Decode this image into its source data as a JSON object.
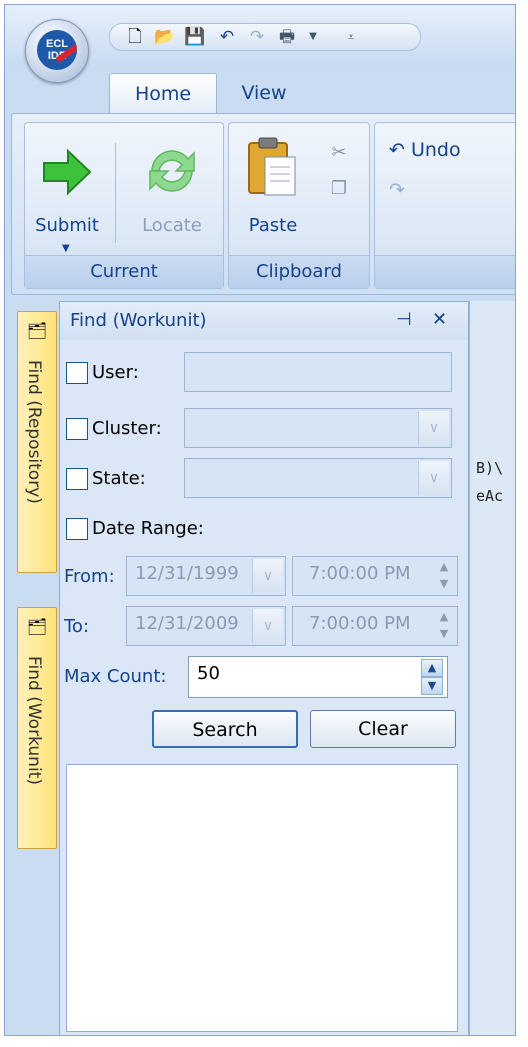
{
  "app": {
    "orb_text_line1": "ECL",
    "orb_text_line2": "IDE"
  },
  "ribbon": {
    "tabs": [
      {
        "label": "Home"
      },
      {
        "label": "View"
      }
    ],
    "groups": {
      "current": {
        "label": "Current",
        "submit_label": "Submit",
        "locate_label": "Locate"
      },
      "clipboard": {
        "label": "Clipboard",
        "paste_label": "Paste"
      },
      "edit": {
        "undo_label": "Undo"
      }
    }
  },
  "sidebar": {
    "tabs": [
      {
        "label": "Find (Repository)"
      },
      {
        "label": "Find (Workunit)"
      }
    ]
  },
  "find_panel": {
    "title": "Find (Workunit)",
    "pin_glyph": "⊣",
    "close_glyph": "✕",
    "user_label": "User:",
    "user_value": "",
    "cluster_label": "Cluster:",
    "cluster_value": "",
    "state_label": "State:",
    "state_value": "",
    "date_range_label": "Date Range:",
    "from_label": "From:",
    "from_date": "12/31/1999",
    "from_time": "7:00:00 PM",
    "to_label": "To:",
    "to_date": "12/31/2009",
    "to_time": "7:00:00 PM",
    "max_count_label": "Max Count:",
    "max_count_value": "50",
    "search_label": "Search",
    "clear_label": "Clear"
  },
  "code_fragments": [
    "B)\\",
    "eAc"
  ]
}
